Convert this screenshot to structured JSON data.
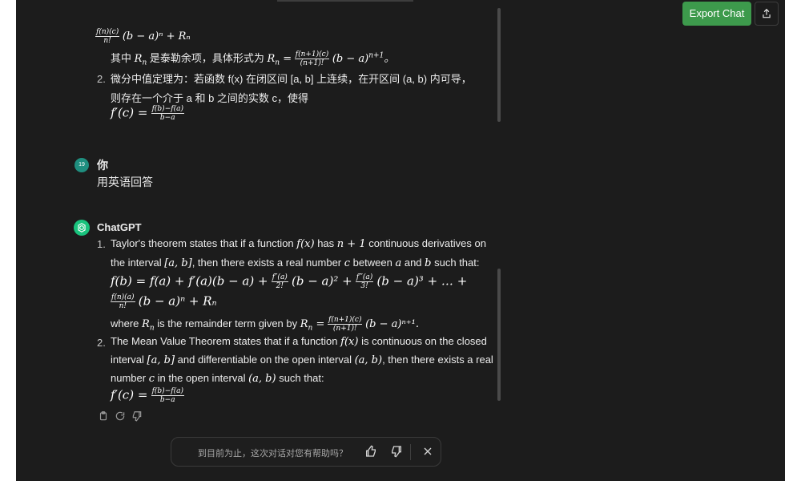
{
  "toolbar": {
    "export_label": "Export Chat",
    "share_icon": "share-upload-icon"
  },
  "previous_answer": {
    "line_top_tail": "(b − a)ⁿ + Rₙ",
    "line_top_frac_num": "f(n)(c)",
    "line_top_frac_den": "n!",
    "line_remainder_a": "其中",
    "line_remainder_b": "是泰勒余项，具体形式为",
    "line_remainder_frac_num": "f(n+1)(c)",
    "line_remainder_frac_den": "(n+1)!",
    "item2_number": "2.",
    "item2_line1": "微分中值定理为：若函数 f(x) 在闭区间 [a, b] 上连续，在开区间 (a, b) 内可导，",
    "item2_line2": "则存在一个介于 a 和 b 之间的实数 c，使得",
    "item2_formula_lhs": "f′(c) =",
    "item2_formula_num": "f(b)−f(a)",
    "item2_formula_den": "b−a"
  },
  "user_message": {
    "avatar_text": "19",
    "author": "你",
    "text": "用英语回答"
  },
  "assistant_message": {
    "author": "ChatGPT",
    "item1_number": "1.",
    "item1_line1_a": "Taylor's theorem states that if a function",
    "item1_line1_b": "has",
    "item1_line1_c": "continuous derivatives on",
    "item1_line2_a": "the interval",
    "item1_line2_b": ", then there exists a real number",
    "item1_line2_c": "between",
    "item1_line2_d": "and",
    "item1_line2_e": "such that:",
    "item1_formula_line1": "f(b) = f(a) + f′(a)(b − a) +",
    "item1_formula_line1_tail": "(b − a)² +",
    "item1_formula_line1_tail2": "(b − a)³ + … +",
    "item1_frac2_num": "f″(a)",
    "item1_frac2_den": "2!",
    "item1_frac3_num": "f‴(a)",
    "item1_frac3_den": "3!",
    "item1_formula_line2_num": "f(n)(a)",
    "item1_formula_line2_den": "n!",
    "item1_formula_line2_tail": "(b − a)ⁿ + Rₙ",
    "item1_where_a": "where",
    "item1_where_b": "is the remainder term given by",
    "item1_where_frac_num": "f(n+1)(c)",
    "item1_where_frac_den": "(n+1)!",
    "item1_where_tail": "(b − a)ⁿ⁺¹.",
    "item2_number": "2.",
    "item2_line1_a": "The Mean Value Theorem states that if a function",
    "item2_line1_b": "is continuous on the closed",
    "item2_line2_a": "interval",
    "item2_line2_b": "and differentiable on the open interval",
    "item2_line2_c": ", then there exists a real",
    "item2_line3_a": "number",
    "item2_line3_b": "in the open interval",
    "item2_line3_c": "such that:",
    "item2_formula_lhs": "f′(c) =",
    "item2_formula_num": "f(b)−f(a)",
    "item2_formula_den": "b−a"
  },
  "feedback": {
    "prompt": "到目前为止，这次对话对您有帮助吗？",
    "thumbs_up_icon": "thumbs-up-icon",
    "thumbs_down_icon": "thumbs-down-icon",
    "close_icon": "close-icon"
  }
}
